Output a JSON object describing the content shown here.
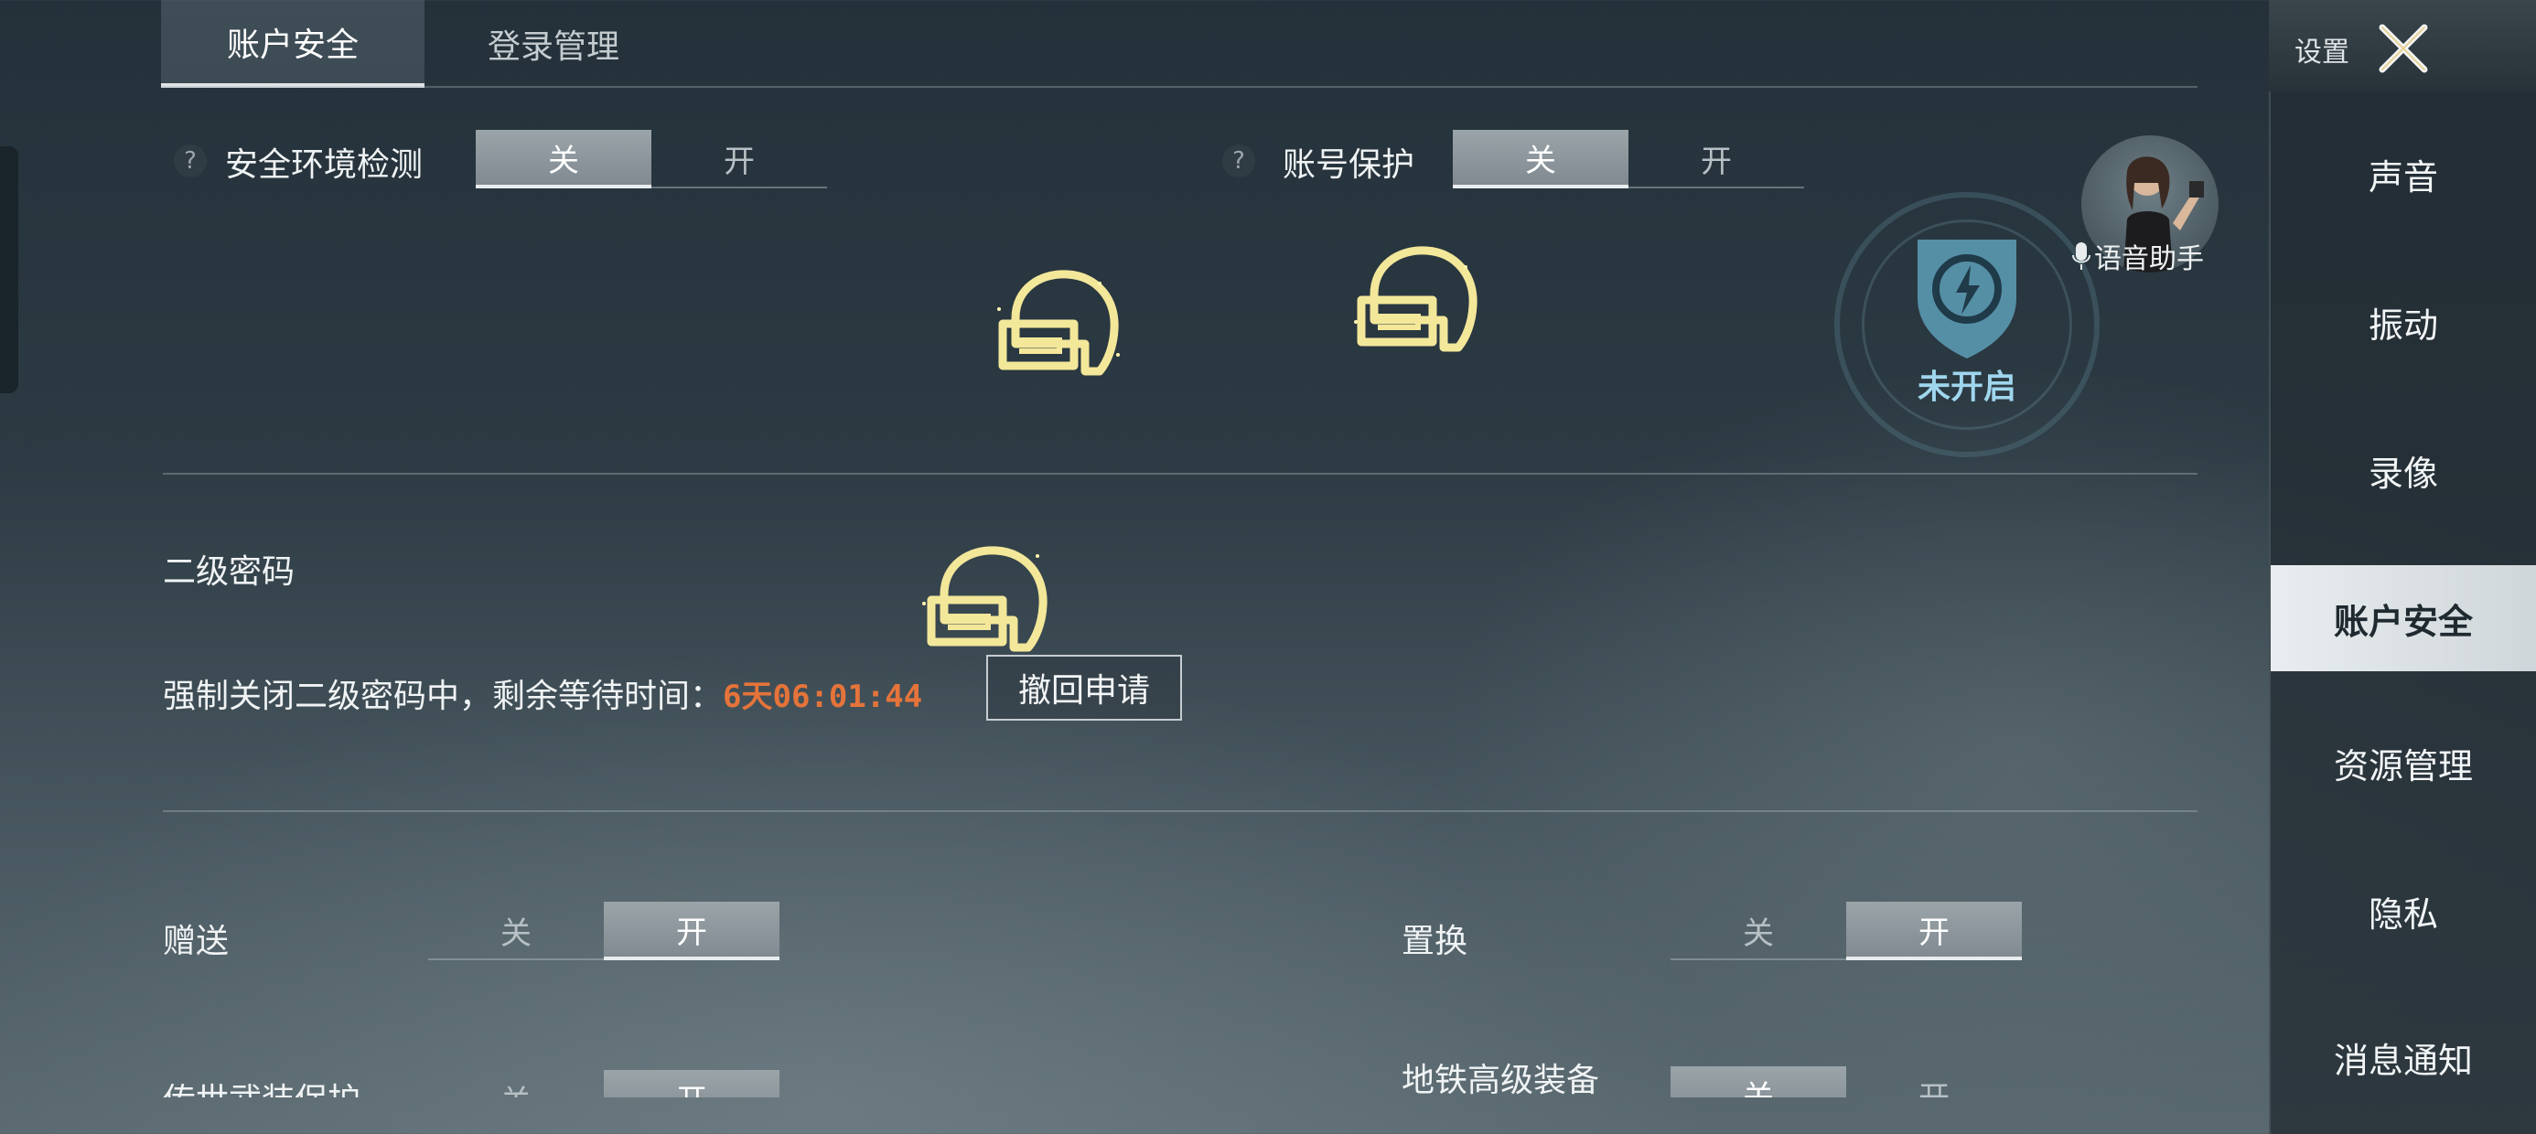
{
  "tabs": {
    "account_security": "账户安全",
    "login_management": "登录管理"
  },
  "security_env": {
    "help": "?",
    "label": "安全环境检测",
    "off": "关",
    "on": "开",
    "state": "off"
  },
  "account_protection": {
    "help": "?",
    "label": "账号保护",
    "off": "关",
    "on": "开",
    "state": "off"
  },
  "shield_badge": {
    "status_text": "未开启",
    "color": "#9fd6ee"
  },
  "voice_assistant": {
    "label": "语音助手"
  },
  "secondary_password": {
    "title": "二级密码",
    "status_prefix": "强制关闭二级密码中，剩余等待时间：",
    "countdown": "6天06:01:44",
    "countdown_color": "#e5743a",
    "revoke_button": "撤回申请"
  },
  "gift": {
    "label": "赠送",
    "off": "关",
    "on": "开",
    "state": "on"
  },
  "exchange": {
    "label": "置换",
    "off": "关",
    "on": "开",
    "state": "on"
  },
  "legendary_weapon_protection": {
    "label": "传世武装保护",
    "off": "关",
    "on": "开",
    "state": "on"
  },
  "metro_advanced_gear": {
    "label": "地铁高级装备",
    "off": "关",
    "on": "开",
    "state": "off"
  },
  "sidebar": {
    "title": "设置",
    "items": [
      {
        "label": "声音"
      },
      {
        "label": "振动"
      },
      {
        "label": "录像"
      },
      {
        "label": "账户安全",
        "active": true
      },
      {
        "label": "资源管理"
      },
      {
        "label": "隐私"
      },
      {
        "label": "消息通知"
      }
    ]
  },
  "icons": {
    "helmet": "gold-helmet-icon",
    "close": "close-icon",
    "mic": "mic-icon",
    "shield": "shield-lightning-icon"
  }
}
